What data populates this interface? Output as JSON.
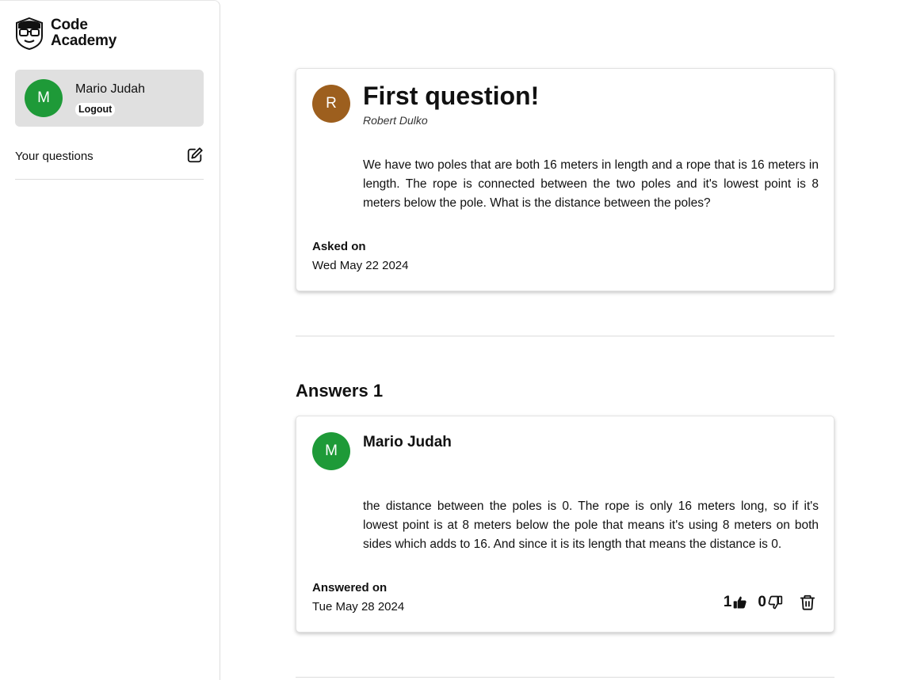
{
  "app": {
    "logo_line1": "Code",
    "logo_line2": "Academy"
  },
  "user": {
    "initial": "M",
    "name": "Mario Judah",
    "logout_label": "Logout",
    "avatar_color": "#1e9a38"
  },
  "nav": {
    "your_questions_label": "Your questions",
    "edit_icon": "edit-square-pen-icon"
  },
  "question": {
    "avatar_initial": "R",
    "avatar_color": "#9d5f1e",
    "title": "First question!",
    "author": "Robert Dulko",
    "body": "We have two poles that are both 16 meters in length and a rope that is 16 meters in length. The rope is connected between the two poles and it's lowest point is 8 meters below the pole. What is the distance between the poles?",
    "asked_label": "Asked on",
    "asked_date": "Wed May 22 2024"
  },
  "answers": {
    "heading": "Answers 1",
    "items": [
      {
        "avatar_initial": "M",
        "avatar_color": "#1e9a38",
        "author": "Mario Judah",
        "body": "the distance between the poles is 0. The rope is only 16 meters long, so if it's lowest point is at 8 meters below the pole that means it's using 8 meters on both sides which adds to 16. And since it is its length that means the distance is 0.",
        "answered_label": "Answered on",
        "answered_date": "Tue May 28 2024",
        "upvotes": "1",
        "downvotes": "0",
        "upvote_icon": "thumbs-up-icon",
        "downvote_icon": "thumbs-down-icon",
        "delete_icon": "trash-icon"
      }
    ]
  }
}
